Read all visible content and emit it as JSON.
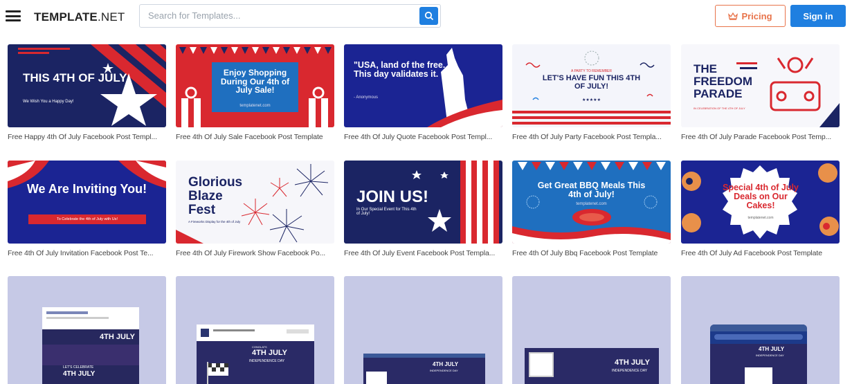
{
  "header": {
    "logo_bold": "TEMPLATE",
    "logo_light": ".NET",
    "search_placeholder": "Search for Templates...",
    "pricing_label": "Pricing",
    "signin_label": "Sign in"
  },
  "row1": [
    {
      "caption": "Free Happy 4th Of July Facebook Post Templ...",
      "title": "THIS 4TH OF JULY",
      "sub": "We Wish You a Happy Day!"
    },
    {
      "caption": "Free 4th Of July Sale Facebook Post Template",
      "title": "Enjoy Shopping During Our 4th of July Sale!",
      "sub": "templatenet.com"
    },
    {
      "caption": "Free 4th Of July Quote Facebook Post Templ...",
      "title": "\"USA, land of the free. This day validates it.",
      "sub": "- Anonymous"
    },
    {
      "caption": "Free 4th Of July Party Facebook Post Templa...",
      "kicker": "A PARTY TO REMEMBER",
      "title": "LET'S HAVE FUN THIS 4TH OF JULY!",
      "sub": "★★★★★"
    },
    {
      "caption": "Free 4th Of July Parade Facebook Post Temp...",
      "title": "THE FREEDOM PARADE",
      "sub": "IN CELEBRATION OF THE 4TH OF JULY"
    }
  ],
  "row2": [
    {
      "caption": "Free 4th Of July Invitation Facebook Post Te...",
      "title": "We Are Inviting You!",
      "sub": "To Celebrate the 4th of July with Us!"
    },
    {
      "caption": "Free 4th Of July Firework Show Facebook Po...",
      "title": "Glorious Blaze Fest",
      "sub": "A Fireworks Display for the 4th of July"
    },
    {
      "caption": "Free 4th Of July Event Facebook Post Templa...",
      "title": "JOIN US!",
      "sub": "In Our Special Event for This 4th of July!"
    },
    {
      "caption": "Free 4th Of July Bbq Facebook Post Template",
      "title": "Get Great BBQ Meals This 4th of July!",
      "sub": "templatenet.com"
    },
    {
      "caption": "Free 4th Of July Ad Facebook Post Template",
      "title": "Special 4th of July Deals on Our Cakes!",
      "sub": "templatenet.com"
    }
  ],
  "row3": [
    {
      "title": "4TH JULY",
      "sub": "LET'S CELEBRATE"
    },
    {
      "title": "4TH JULY",
      "sub": "INDEPENDENCE DAY"
    },
    {
      "title": "4TH JULY",
      "sub": "INDEPENDENCE DAY"
    },
    {
      "title": "4TH JULY",
      "sub": "INDEPENDENCE DAY"
    },
    {
      "title": "4TH JULY",
      "sub": "INDEPENDENCE DAY"
    }
  ],
  "colors": {
    "navy": "#1b2463",
    "red": "#d9282f",
    "blue": "#1f7fe0",
    "orange": "#e8734a",
    "mock_bg": "#c6c9e6"
  }
}
